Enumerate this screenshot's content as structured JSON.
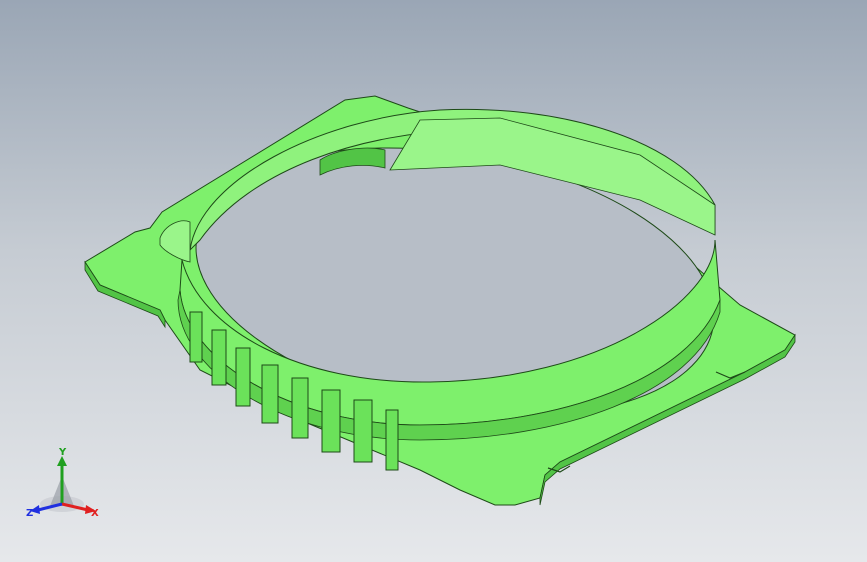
{
  "viewport": {
    "background_top": "#9aa6b5",
    "background_bottom": "#e6e8eb"
  },
  "model": {
    "color_face": "#7ef06c",
    "color_light": "#9af58a",
    "color_shade": "#52c446",
    "edge_color": "#1e4a18"
  },
  "triad": {
    "x_label": "X",
    "y_label": "Y",
    "z_label": "Z",
    "x_color": "#e02020",
    "y_color": "#20a020",
    "z_color": "#2030e0"
  }
}
